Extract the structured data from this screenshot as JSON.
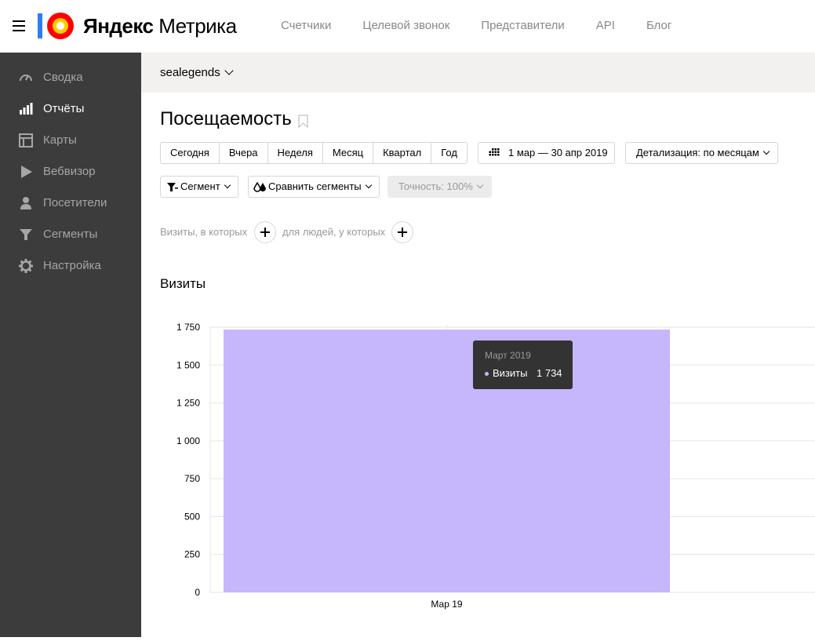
{
  "header": {
    "brand_yandex": "Яндекс",
    "brand_product": "Метрика",
    "nav": [
      "Счетчики",
      "Целевой звонок",
      "Представители",
      "API",
      "Блог"
    ]
  },
  "sidebar": {
    "items": [
      {
        "label": "Сводка",
        "icon": "dashboard-icon",
        "active": false
      },
      {
        "label": "Отчёты",
        "icon": "bar-chart-icon",
        "active": true
      },
      {
        "label": "Карты",
        "icon": "layout-map-icon",
        "active": false
      },
      {
        "label": "Вебвизор",
        "icon": "play-icon",
        "active": false
      },
      {
        "label": "Посетители",
        "icon": "user-icon",
        "active": false
      },
      {
        "label": "Сегменты",
        "icon": "filter-icon",
        "active": false
      },
      {
        "label": "Настройка",
        "icon": "gear-icon",
        "active": false
      }
    ]
  },
  "counter": {
    "name": "sealegends"
  },
  "report": {
    "title": "Посещаемость",
    "periods": [
      "Сегодня",
      "Вчера",
      "Неделя",
      "Месяц",
      "Квартал",
      "Год"
    ],
    "date_range": "1 мар — 30 апр 2019",
    "detail": "Детализация: по месяцам",
    "segment": "Сегмент",
    "compare": "Сравнить сегменты",
    "precision": "Точность: 100%",
    "visits_where": "Визиты, в которых",
    "people_where": "для людей, у которых",
    "section": "Визиты"
  },
  "tooltip": {
    "title": "Март 2019",
    "series": "Визиты",
    "value": "1 734"
  },
  "colors": {
    "sidebar_bg": "#3c3c3c",
    "bar": "#c6b6fb",
    "tooltip_bg": "#333333",
    "logo_red": "#ff0000",
    "logo_yellow": "#ffcc00",
    "logo_blue": "#2d7cf6"
  },
  "chart_data": {
    "type": "bar",
    "categories": [
      "Мар 19"
    ],
    "series": [
      {
        "name": "Визиты",
        "values": [
          1734
        ]
      }
    ],
    "ylim": [
      0,
      1750
    ],
    "yticks": [
      0,
      250,
      500,
      750,
      1000,
      1250,
      1500,
      1750
    ],
    "ytick_labels": [
      "0",
      "250",
      "500",
      "750",
      "1 000",
      "1 250",
      "1 500",
      "1 750"
    ],
    "grid": true
  }
}
